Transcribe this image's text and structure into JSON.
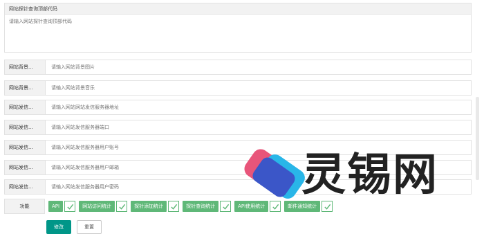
{
  "header": {
    "title": "网站探针查询顶部代码"
  },
  "top_code": {
    "placeholder": "请输入网站探针查询顶部代码"
  },
  "fields": [
    {
      "label": "网站背景...",
      "placeholder": "请输入网站背景图片"
    },
    {
      "label": "网站背景...",
      "placeholder": "请输入网站背景音乐"
    },
    {
      "label": "网站发信...",
      "placeholder": "请输入网站网站发信服务器地址"
    },
    {
      "label": "网站发信...",
      "placeholder": "请输入网站发信服务器端口"
    },
    {
      "label": "网站发信...",
      "placeholder": "请输入网站发信服务器用户账号"
    },
    {
      "label": "网站发信...",
      "placeholder": "请输入网站发信服务器用户邮箱"
    },
    {
      "label": "网站发信...",
      "placeholder": "请输入网站发信服务器用户密码"
    }
  ],
  "features": {
    "label": "功能",
    "items": [
      {
        "label": "API",
        "checked": true
      },
      {
        "label": "网站访问统计",
        "checked": true
      },
      {
        "label": "探针添加统计",
        "checked": true
      },
      {
        "label": "探针查询统计",
        "checked": true
      },
      {
        "label": "API使用统计",
        "checked": true
      },
      {
        "label": "邮件通知统计",
        "checked": true
      }
    ]
  },
  "buttons": {
    "submit": "修改",
    "reset": "重置"
  },
  "watermark": {
    "text": "灵锡网",
    "colors": {
      "pink": "#e8557a",
      "blue": "#3b56c8",
      "cyan": "#29b6e8"
    }
  }
}
